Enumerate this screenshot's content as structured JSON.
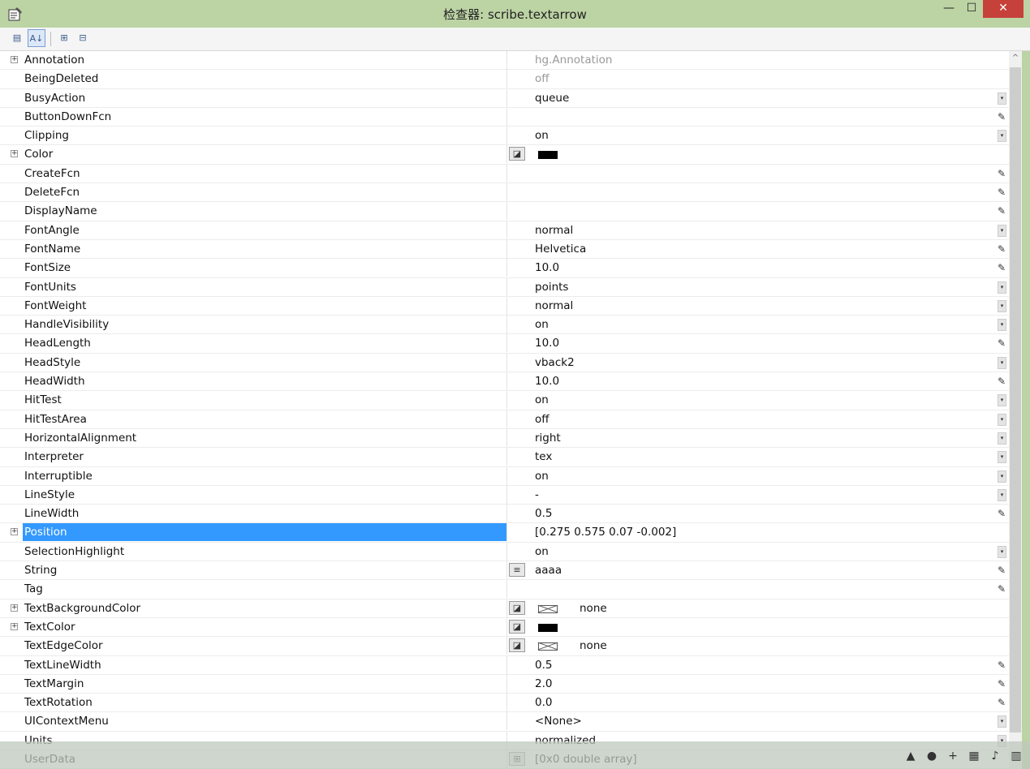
{
  "window": {
    "title": "检查器:  scribe.textarrow",
    "minimize": "—",
    "maximize": "☐",
    "close": "✕"
  },
  "toolbar": {
    "buttons": [
      "▤",
      "A↓",
      "⊞",
      "⊟"
    ]
  },
  "rows": [
    {
      "name": "Annotation",
      "value": "hg.Annotation",
      "readonly": true,
      "expand": true
    },
    {
      "name": "BeingDeleted",
      "value": "off",
      "readonly": true
    },
    {
      "name": "BusyAction",
      "value": "queue",
      "control": "dropdown"
    },
    {
      "name": "ButtonDownFcn",
      "value": "",
      "control": "edit"
    },
    {
      "name": "Clipping",
      "value": "on",
      "control": "dropdown"
    },
    {
      "name": "Color",
      "value": "",
      "expand": true,
      "swatch": "black",
      "colorbtn": true
    },
    {
      "name": "CreateFcn",
      "value": "",
      "control": "edit"
    },
    {
      "name": "DeleteFcn",
      "value": "",
      "control": "edit"
    },
    {
      "name": "DisplayName",
      "value": "",
      "control": "edit"
    },
    {
      "name": "FontAngle",
      "value": "normal",
      "control": "dropdown"
    },
    {
      "name": "FontName",
      "value": "Helvetica",
      "control": "edit"
    },
    {
      "name": "FontSize",
      "value": "10.0",
      "control": "edit"
    },
    {
      "name": "FontUnits",
      "value": "points",
      "control": "dropdown"
    },
    {
      "name": "FontWeight",
      "value": "normal",
      "control": "dropdown"
    },
    {
      "name": "HandleVisibility",
      "value": "on",
      "control": "dropdown"
    },
    {
      "name": "HeadLength",
      "value": "10.0",
      "control": "edit"
    },
    {
      "name": "HeadStyle",
      "value": "vback2",
      "control": "dropdown"
    },
    {
      "name": "HeadWidth",
      "value": "10.0",
      "control": "edit"
    },
    {
      "name": "HitTest",
      "value": "on",
      "control": "dropdown"
    },
    {
      "name": "HitTestArea",
      "value": "off",
      "control": "dropdown"
    },
    {
      "name": "HorizontalAlignment",
      "value": "right",
      "control": "dropdown"
    },
    {
      "name": "Interpreter",
      "value": "tex",
      "control": "dropdown"
    },
    {
      "name": "Interruptible",
      "value": "on",
      "control": "dropdown"
    },
    {
      "name": "LineStyle",
      "value": "-",
      "control": "dropdown"
    },
    {
      "name": "LineWidth",
      "value": "0.5",
      "control": "edit"
    },
    {
      "name": "Position",
      "value": "[0.275 0.575 0.07 -0.002]",
      "expand": true,
      "selected": true
    },
    {
      "name": "SelectionHighlight",
      "value": "on",
      "control": "dropdown"
    },
    {
      "name": "String",
      "value": "aaaa",
      "control": "edit",
      "textbtn": true
    },
    {
      "name": "Tag",
      "value": "",
      "control": "edit"
    },
    {
      "name": "TextBackgroundColor",
      "value": "none",
      "expand": true,
      "swatch": "none",
      "colorbtn": true
    },
    {
      "name": "TextColor",
      "value": "",
      "expand": true,
      "swatch": "black",
      "colorbtn": true
    },
    {
      "name": "TextEdgeColor",
      "value": "none",
      "swatch": "none",
      "colorbtn": true
    },
    {
      "name": "TextLineWidth",
      "value": "0.5",
      "control": "edit"
    },
    {
      "name": "TextMargin",
      "value": "2.0",
      "control": "edit"
    },
    {
      "name": "TextRotation",
      "value": "0.0",
      "control": "edit"
    },
    {
      "name": "UIContextMenu",
      "value": "<None>",
      "control": "dropdown"
    },
    {
      "name": "Units",
      "value": "normalized",
      "control": "dropdown"
    },
    {
      "name": "UserData",
      "value": "[0x0  double array]",
      "arraybtn": true
    }
  ],
  "colors": {
    "selection": "#3399ff",
    "titlebar": "#bcd3a4",
    "close": "#c7413b"
  }
}
